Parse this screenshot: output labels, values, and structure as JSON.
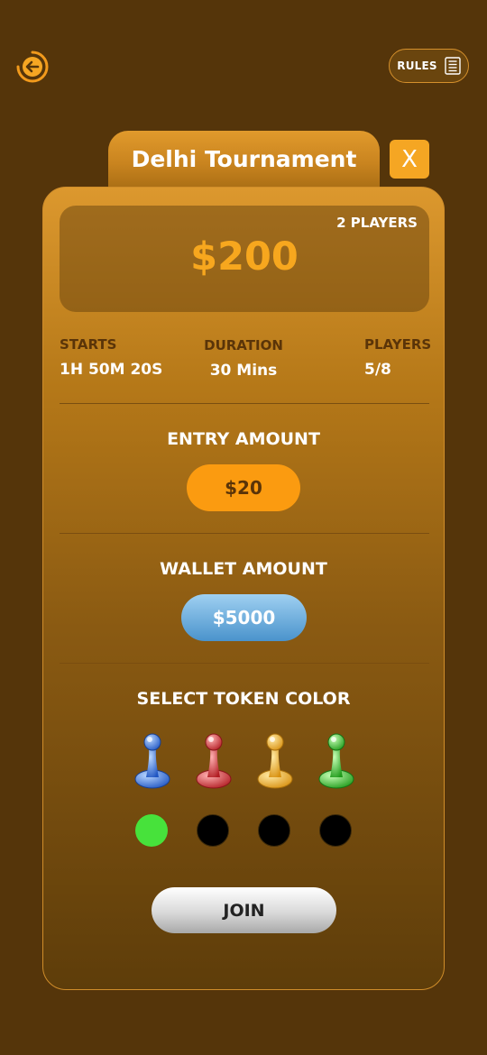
{
  "header": {
    "back_icon": "back-arrow-icon",
    "rules_label": "RULES",
    "rules_icon": "document-icon"
  },
  "tournament": {
    "title": "Delhi Tournament",
    "close_label": "X",
    "players_badge": "2 PLAYERS",
    "prize": "$200"
  },
  "stats": {
    "starts_label": "STARTS",
    "starts_value": "1H 50M 20S",
    "duration_label": "DURATION",
    "duration_value": "30 Mins",
    "players_label": "PLAYERS",
    "players_value": "5/8"
  },
  "entry": {
    "title": "ENTRY AMOUNT",
    "amount": "$20"
  },
  "wallet": {
    "title": "WALLET AMOUNT",
    "amount": "$5000"
  },
  "tokens": {
    "title": "SELECT TOKEN COLOR",
    "colors": [
      {
        "name": "blue",
        "hex": "#3f7fe0",
        "selected": true
      },
      {
        "name": "red",
        "hex": "#d93a3a",
        "selected": false
      },
      {
        "name": "yellow",
        "hex": "#f0b22a",
        "selected": false
      },
      {
        "name": "green",
        "hex": "#3cbe34",
        "selected": false
      }
    ],
    "selected_indicator_color": "#47e23b"
  },
  "join_label": "JOIN",
  "colors": {
    "background": "#55350a",
    "accent": "#f5a623",
    "prize": "#f7a71e"
  }
}
